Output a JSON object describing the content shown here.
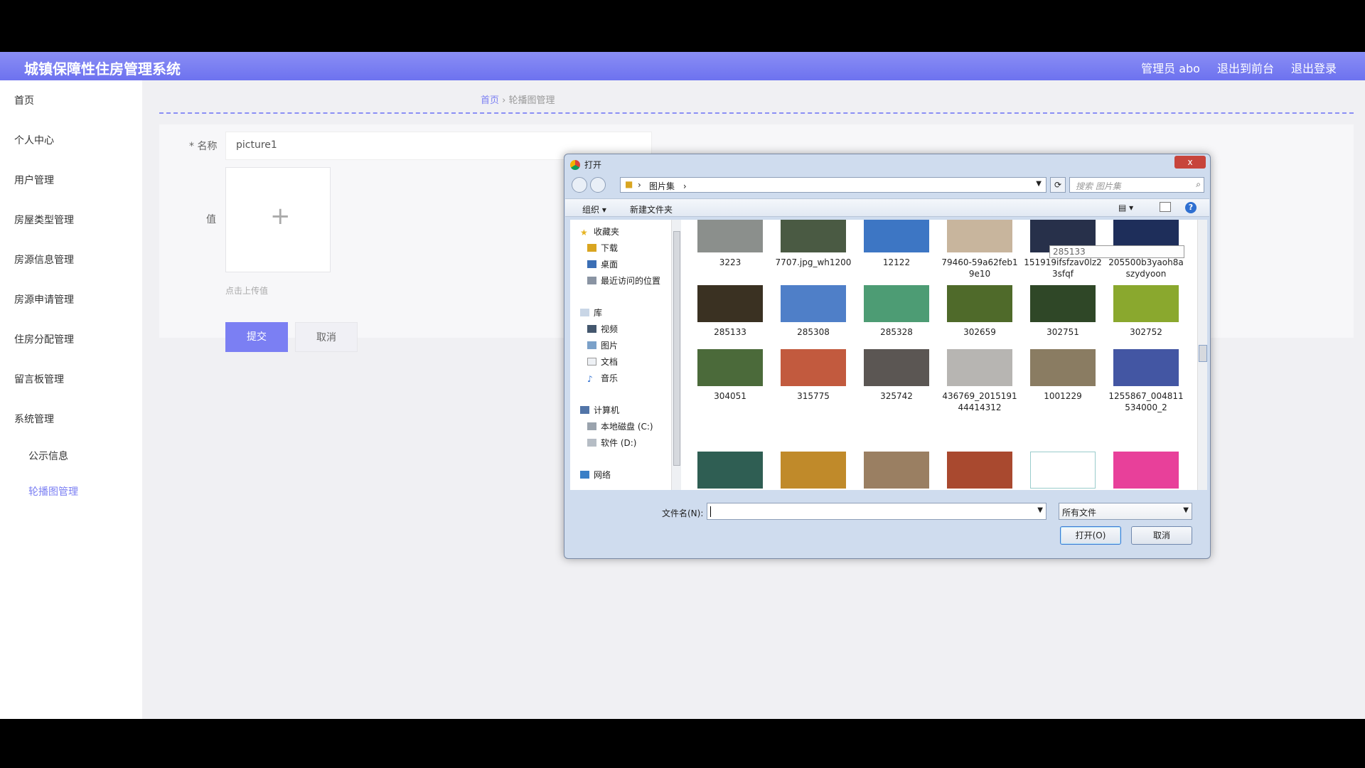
{
  "header": {
    "title": "城镇保障性住房管理系统",
    "admin": "管理员 abo",
    "front": "退出到前台",
    "logout": "退出登录"
  },
  "sidebar": {
    "items": [
      "首页",
      "个人中心",
      "用户管理",
      "房屋类型管理",
      "房源信息管理",
      "房源申请管理",
      "住房分配管理",
      "留言板管理",
      "系统管理"
    ],
    "sub": [
      "公示信息",
      "轮播图管理"
    ]
  },
  "breadcrumb": {
    "home": "首页",
    "sep": "›",
    "current": "轮播图管理"
  },
  "form": {
    "name_label": "* 名称",
    "name_value": "picture1",
    "value_label": "值",
    "upload_hint": "点击上传值",
    "submit": "提交",
    "cancel": "取消"
  },
  "dialog": {
    "title": "打开",
    "close": "x",
    "path": "图片集",
    "search_placeholder": "搜索 图片集",
    "organize": "组织 ▾",
    "new_folder": "新建文件夹",
    "view": "▾",
    "help": "?",
    "tree": {
      "favorites": "收藏夹",
      "downloads": "下载",
      "desktop": "桌面",
      "recent": "最近访问的位置",
      "library": "库",
      "video": "视频",
      "pictures": "图片",
      "documents": "文档",
      "music": "音乐",
      "computer": "计算机",
      "disk_c": "本地磁盘 (C:)",
      "disk_d": "软件 (D:)",
      "network": "网络"
    },
    "files": [
      {
        "name": "3223",
        "color": "#8b8f8c"
      },
      {
        "name": "7707.jpg_wh1200",
        "color": "#4a5a43"
      },
      {
        "name": "12122",
        "color": "#3d76c4"
      },
      {
        "name": "79460-59a62feb19e10",
        "color": "#c8b59d"
      },
      {
        "name": "151919ifsfzav0lz23sfqf",
        "color": "#27304a"
      },
      {
        "name": "205500b3yaoh8aszydyoon",
        "color": "#1e2e5a"
      },
      {
        "name": "285133",
        "color": "#3a3122"
      },
      {
        "name": "285308",
        "color": "#4f7fc8"
      },
      {
        "name": "285328",
        "color": "#4d9c74"
      },
      {
        "name": "302659",
        "color": "#4f6a2a"
      },
      {
        "name": "302751",
        "color": "#2f4727"
      },
      {
        "name": "302752",
        "color": "#8aa82e"
      },
      {
        "name": "304051",
        "color": "#4b6a3a"
      },
      {
        "name": "315775",
        "color": "#c25a3e"
      },
      {
        "name": "325742",
        "color": "#5b5653"
      },
      {
        "name": "436769_201519144414312",
        "color": "#b7b5b2"
      },
      {
        "name": "1001229",
        "color": "#8a7c62"
      },
      {
        "name": "1255867_004811534000_2",
        "color": "#4356a3"
      },
      {
        "name": "",
        "color": "#2f5e53"
      },
      {
        "name": "",
        "color": "#c08a2a"
      },
      {
        "name": "",
        "color": "#9a7f62"
      },
      {
        "name": "",
        "color": "#a9492f"
      },
      {
        "name": "",
        "color": "#ffffff"
      },
      {
        "name": "",
        "color": "#e8409a"
      }
    ],
    "tooltip": "285133",
    "filename_label": "文件名(N):",
    "filetype": "所有文件",
    "open": "打开(O)",
    "cancel": "取消"
  }
}
